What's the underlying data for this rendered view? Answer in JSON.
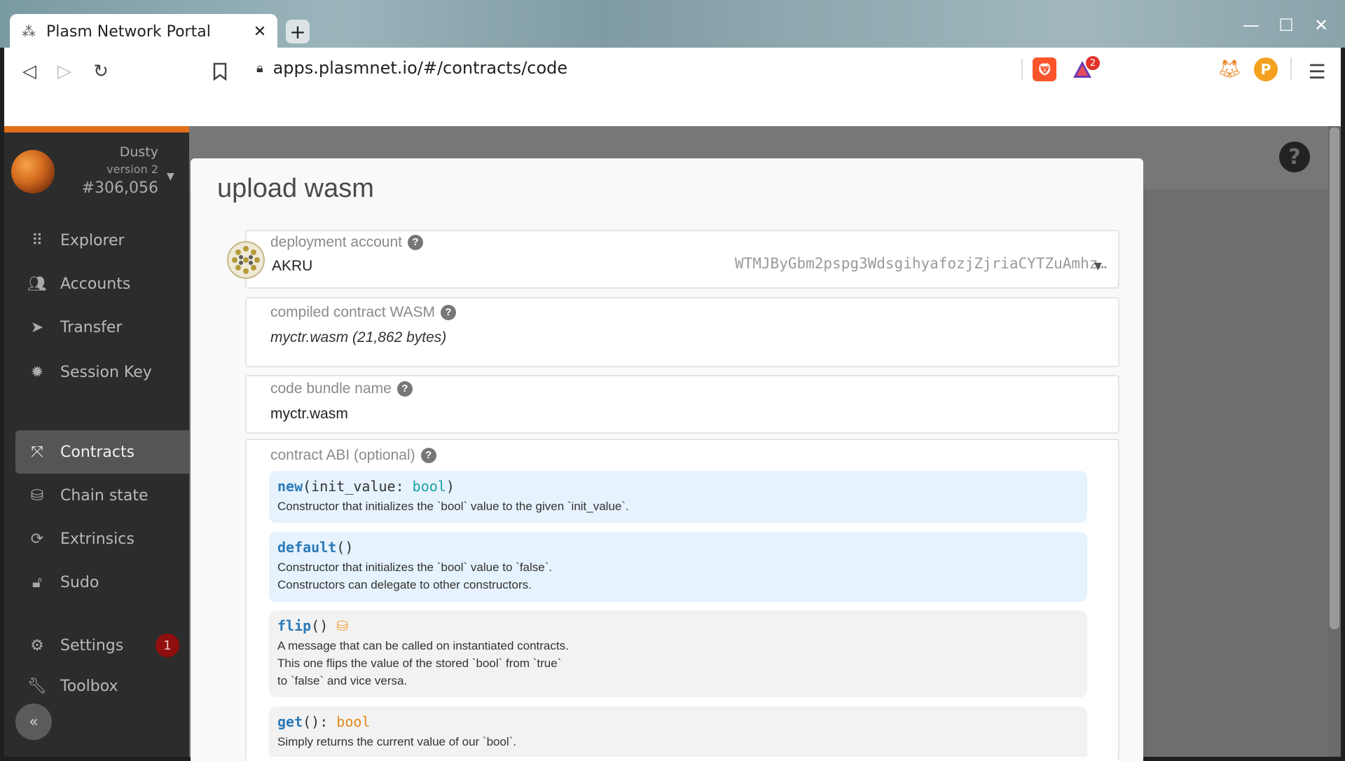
{
  "browser": {
    "tab_title": "Plasm Network Portal",
    "url": "apps.plasmnet.io/#/contracts/code",
    "brave_badge_count": "2"
  },
  "sidebar": {
    "chain": {
      "name": "Dusty",
      "version": "version 2",
      "block": "#306,056"
    },
    "items": [
      {
        "label": "Explorer",
        "icon": "explorer-icon"
      },
      {
        "label": "Accounts",
        "icon": "users-icon"
      },
      {
        "label": "Transfer",
        "icon": "send-icon"
      },
      {
        "label": "Session Key",
        "icon": "gear-icon"
      },
      {
        "label": "Contracts",
        "icon": "compress-icon",
        "active": true
      },
      {
        "label": "Chain state",
        "icon": "database-icon"
      },
      {
        "label": "Extrinsics",
        "icon": "sync-icon"
      },
      {
        "label": "Sudo",
        "icon": "unlock-icon"
      },
      {
        "label": "Settings",
        "icon": "cogs-icon"
      },
      {
        "label": "Toolbox",
        "icon": "wrench-icon"
      }
    ],
    "settings_badge": "1"
  },
  "modal": {
    "title": "upload wasm",
    "deployment_account": {
      "label": "deployment account",
      "name": "AKRU",
      "address": "WTMJByGbm2pspg3WdsgihyafozjZjriaCYTZuAmhz…"
    },
    "wasm": {
      "label": "compiled contract WASM",
      "value": "myctr.wasm (21,862 bytes)"
    },
    "bundle": {
      "label": "code bundle name",
      "value": "myctr.wasm"
    },
    "abi": {
      "label": "contract ABI (optional)",
      "items": [
        {
          "name": "new",
          "open": "(init_value: ",
          "type": "bool",
          "close": ")",
          "docs": [
            "Constructor that initializes the `bool` value to the given `init_value`."
          ]
        },
        {
          "name": "default",
          "open": "()",
          "docs": [
            "Constructor that initializes the `bool` value to `false`.",
            "Constructors can delegate to other constructors."
          ]
        },
        {
          "name": "flip",
          "open": "()",
          "docs": [
            "A message that can be called on instantiated contracts.",
            "This one flips the value of the stored `bool` from `true`",
            "to `false` and vice versa."
          ]
        },
        {
          "name": "get",
          "open": "(): ",
          "ret": "bool",
          "docs": [
            "Simply returns the current value of our `bool`."
          ]
        }
      ]
    }
  }
}
